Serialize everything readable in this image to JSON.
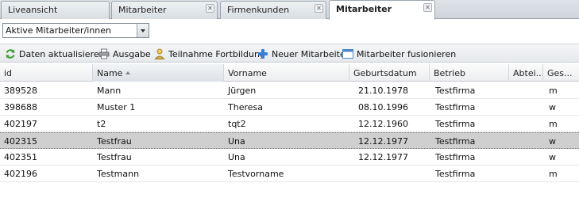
{
  "tabs": [
    {
      "label": "Liveansicht",
      "closable": false,
      "active": false
    },
    {
      "label": "Mitarbeiter",
      "closable": true,
      "active": false
    },
    {
      "label": "Firmenkunden",
      "closable": true,
      "active": false
    },
    {
      "label": "Mitarbeiter",
      "closable": true,
      "active": true
    }
  ],
  "filter": {
    "selected": "Aktive Mitarbeiter/innen"
  },
  "toolbar": {
    "refresh_label": "Daten aktualisieren",
    "print_label": "Ausgabe",
    "training_label": "Teilnahme Fortbildung",
    "new_label": "Neuer Mitarbeiter",
    "merge_label": "Mitarbeiter fusionieren"
  },
  "icons": {
    "refresh": "refresh-icon",
    "print": "printer-icon",
    "training": "user-icon",
    "new": "plus-icon",
    "merge": "window-icon"
  },
  "colors": {
    "refresh": "#3a9c2f",
    "training": "#d8b24a",
    "new": "#3b7fd4",
    "merge": "#4d87c9",
    "selected_row": "#cfcfcf"
  },
  "grid": {
    "columns": [
      "id",
      "Name",
      "Vorname",
      "Geburtsdatum",
      "Betrieb",
      "Abtei...",
      "Ges..."
    ],
    "sorted_column": "Name",
    "sort_direction": "ascending",
    "rows": [
      {
        "id": "389528",
        "name": "Mann",
        "vorname": "Jürgen",
        "geburtsdatum": "21.10.1978",
        "betrieb": "Testfirma",
        "abteilung": "",
        "geschlecht": "m",
        "selected": false
      },
      {
        "id": "398688",
        "name": "Muster 1",
        "vorname": "Theresa",
        "geburtsdatum": "08.10.1996",
        "betrieb": "Testfirma",
        "abteilung": "",
        "geschlecht": "w",
        "selected": false
      },
      {
        "id": "402197",
        "name": "t2",
        "vorname": "tqt2",
        "geburtsdatum": "12.12.1960",
        "betrieb": "Testfirma",
        "abteilung": "",
        "geschlecht": "m",
        "selected": false
      },
      {
        "id": "402315",
        "name": "Testfrau",
        "vorname": "Una",
        "geburtsdatum": "12.12.1977",
        "betrieb": "Testfirma",
        "abteilung": "",
        "geschlecht": "w",
        "selected": true
      },
      {
        "id": "402351",
        "name": "Testfrau",
        "vorname": "Una",
        "geburtsdatum": "12.12.1977",
        "betrieb": "Testfirma",
        "abteilung": "",
        "geschlecht": "w",
        "selected": false
      },
      {
        "id": "402196",
        "name": "Testmann",
        "vorname": "Testvorname",
        "geburtsdatum": "",
        "betrieb": "Testfirma",
        "abteilung": "",
        "geschlecht": "m",
        "selected": false
      }
    ]
  }
}
